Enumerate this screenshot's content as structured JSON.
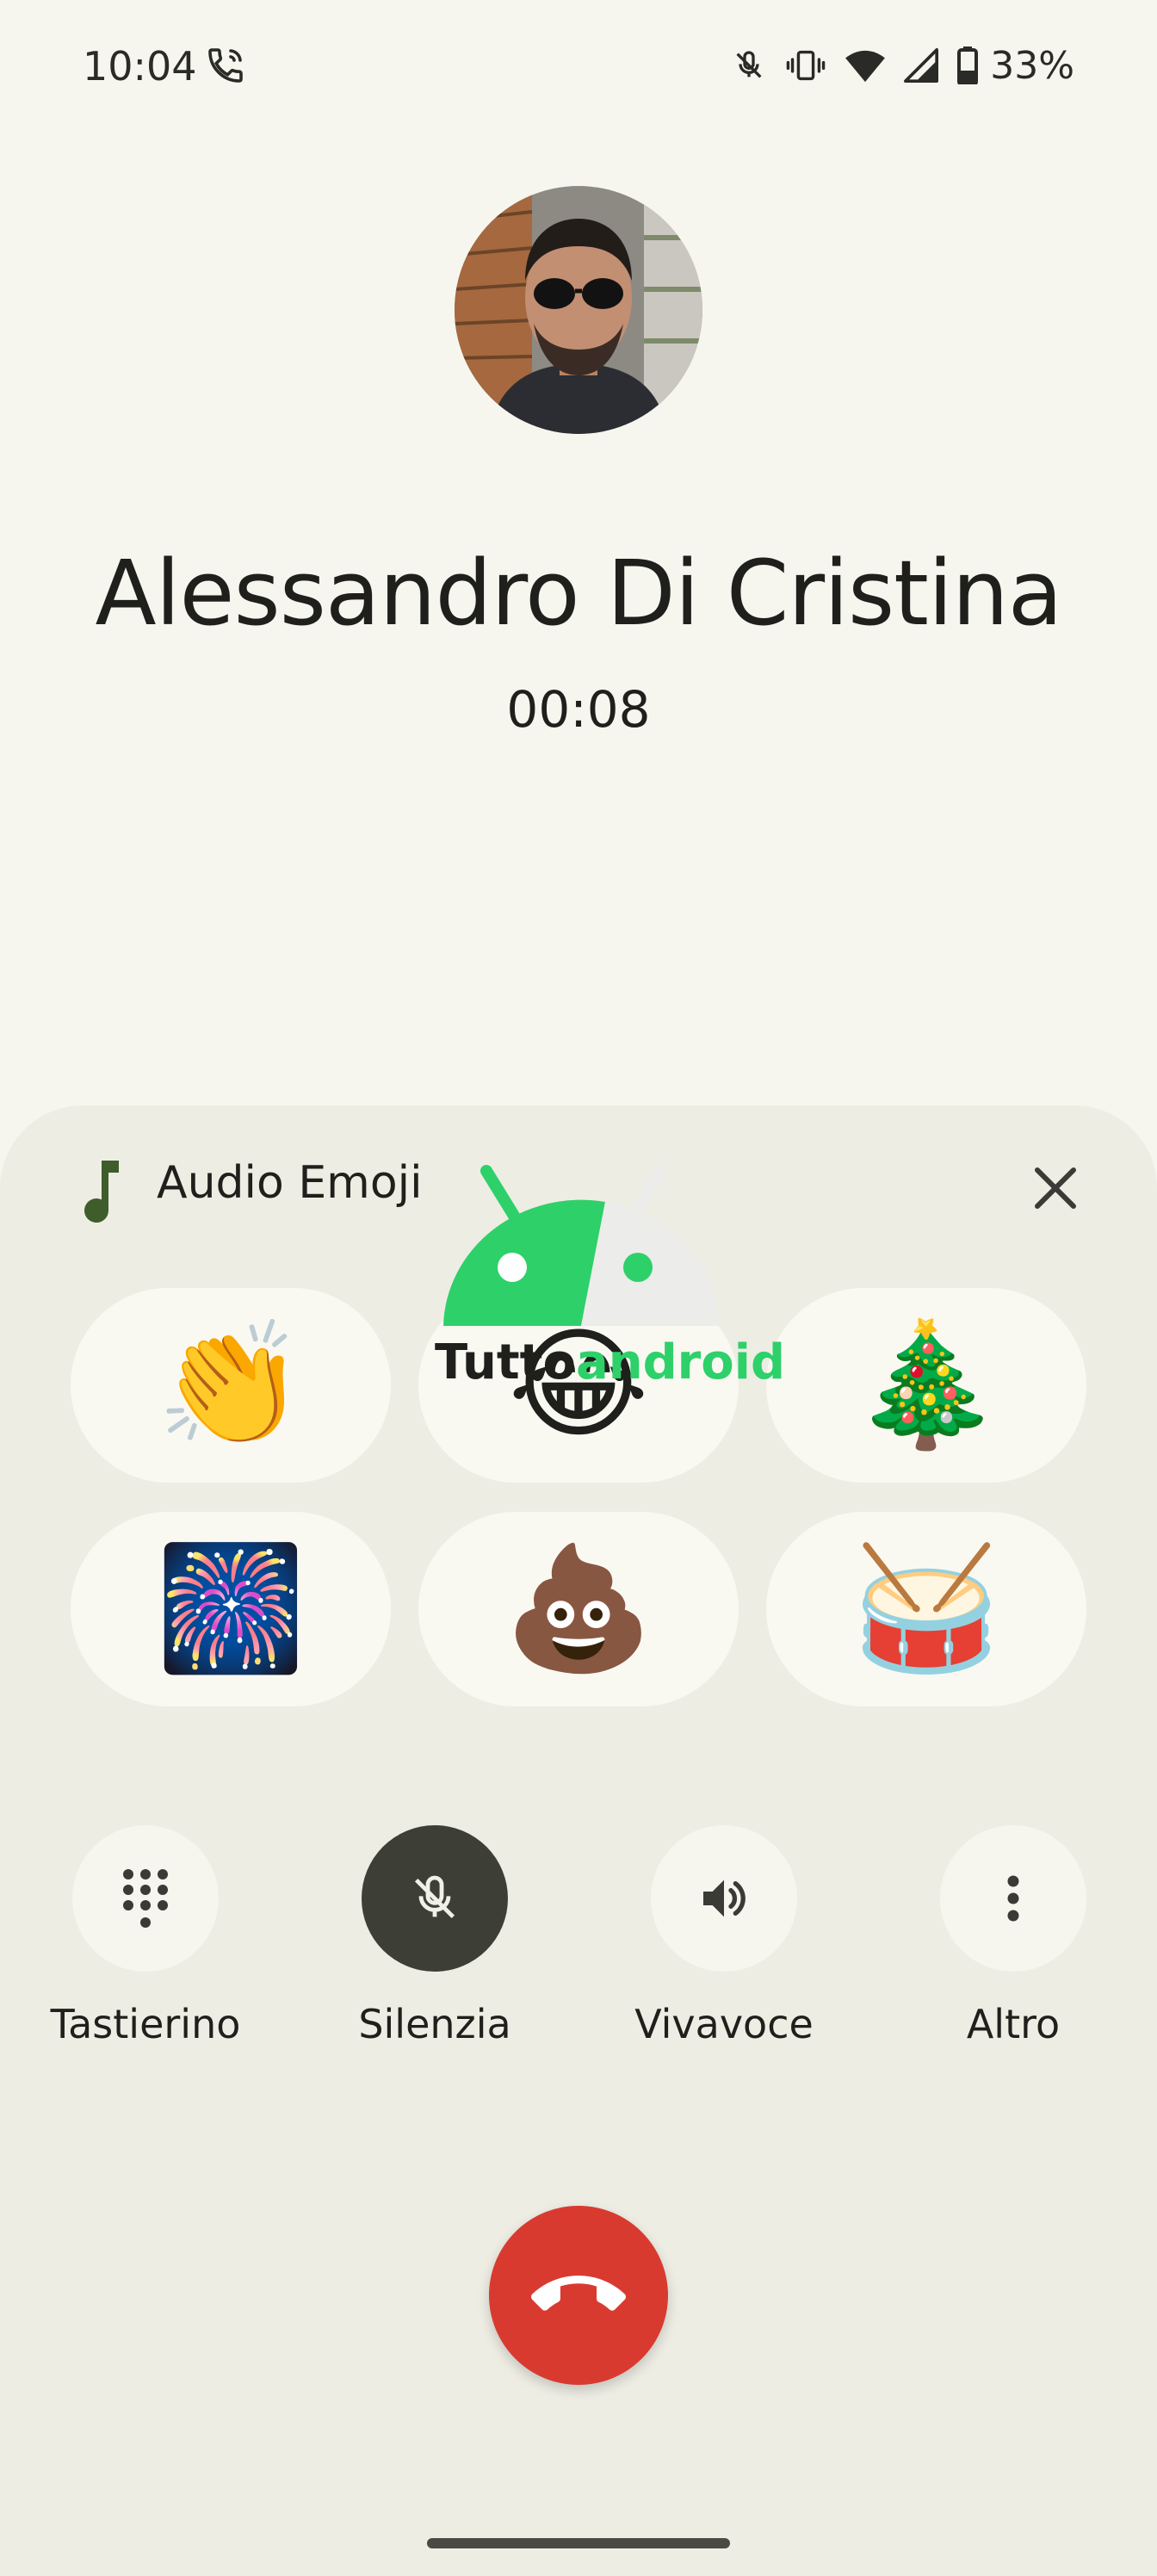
{
  "status_bar": {
    "time": "10:04",
    "battery": "33%",
    "icons": [
      "call-active-icon",
      "mic-muted-icon",
      "vibrate-icon",
      "wifi-icon",
      "signal-icon",
      "battery-icon"
    ]
  },
  "caller": {
    "name": "Alessandro Di Cristina",
    "timer": "00:08",
    "avatar": "avatar-photo"
  },
  "audio_emoji": {
    "title": "Audio Emoji",
    "items": [
      {
        "label": "clapping-hands",
        "glyph": "👏"
      },
      {
        "label": "laughing-crying",
        "glyph": "😂"
      },
      {
        "label": "christmas-tree",
        "glyph": "🎄"
      },
      {
        "label": "fireworks",
        "glyph": "🎆"
      },
      {
        "label": "poop",
        "glyph": "💩"
      },
      {
        "label": "drum",
        "glyph": "🥁"
      }
    ]
  },
  "controls": [
    {
      "label": "Tastierino",
      "icon": "dialpad-icon",
      "active": false
    },
    {
      "label": "Silenzia",
      "icon": "mic-off-icon",
      "active": true
    },
    {
      "label": "Vivavoce",
      "icon": "speaker-icon",
      "active": false
    },
    {
      "label": "Altro",
      "icon": "more-vert-icon",
      "active": false
    }
  ],
  "watermark": {
    "part1": "Tutto",
    "part2": "android"
  },
  "colors": {
    "background": "#f6f6ef",
    "sheet": "#edede4",
    "end_call": "#d93a30",
    "active_control": "#3d3f37",
    "music_icon": "#3e5d2a"
  }
}
